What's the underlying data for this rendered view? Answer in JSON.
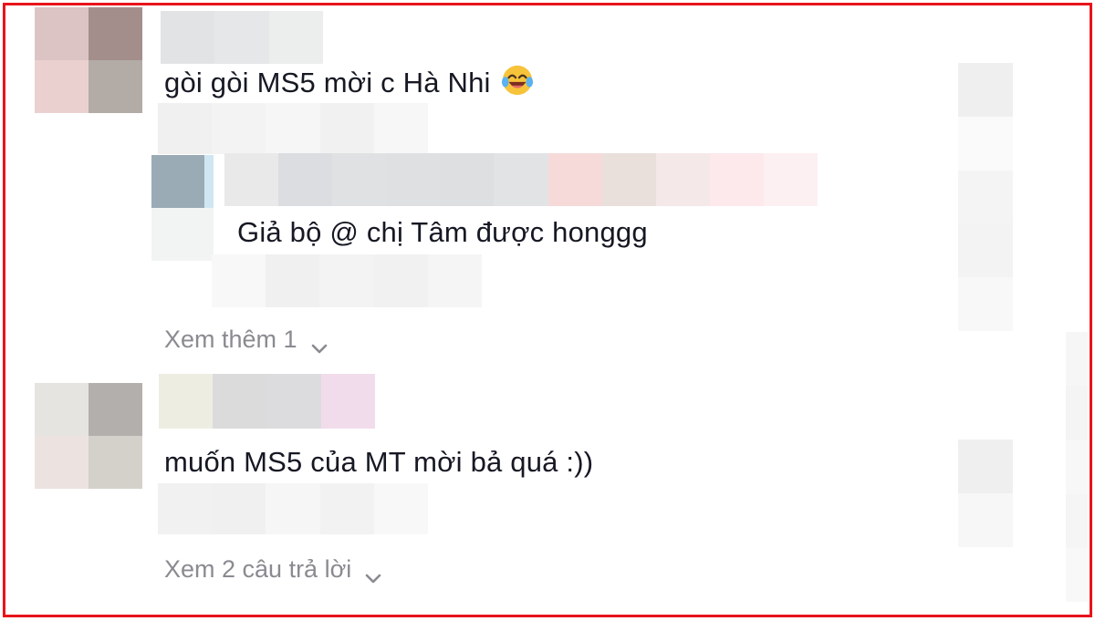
{
  "comments": [
    {
      "text": "gòi gòi MS5 mời c Hà Nhi",
      "emoji": "laughing-tears-emoji",
      "reply": {
        "text": "Giả bộ @ chị Tâm được honggg"
      },
      "more_label": "Xem thêm 1"
    },
    {
      "text": "muốn MS5 của MT mời bả quá :))",
      "more_label": "Xem 2 câu trả lời"
    }
  ],
  "colors": {
    "frame": "#e8141b",
    "text": "#161823",
    "muted": "#8a8b91"
  }
}
